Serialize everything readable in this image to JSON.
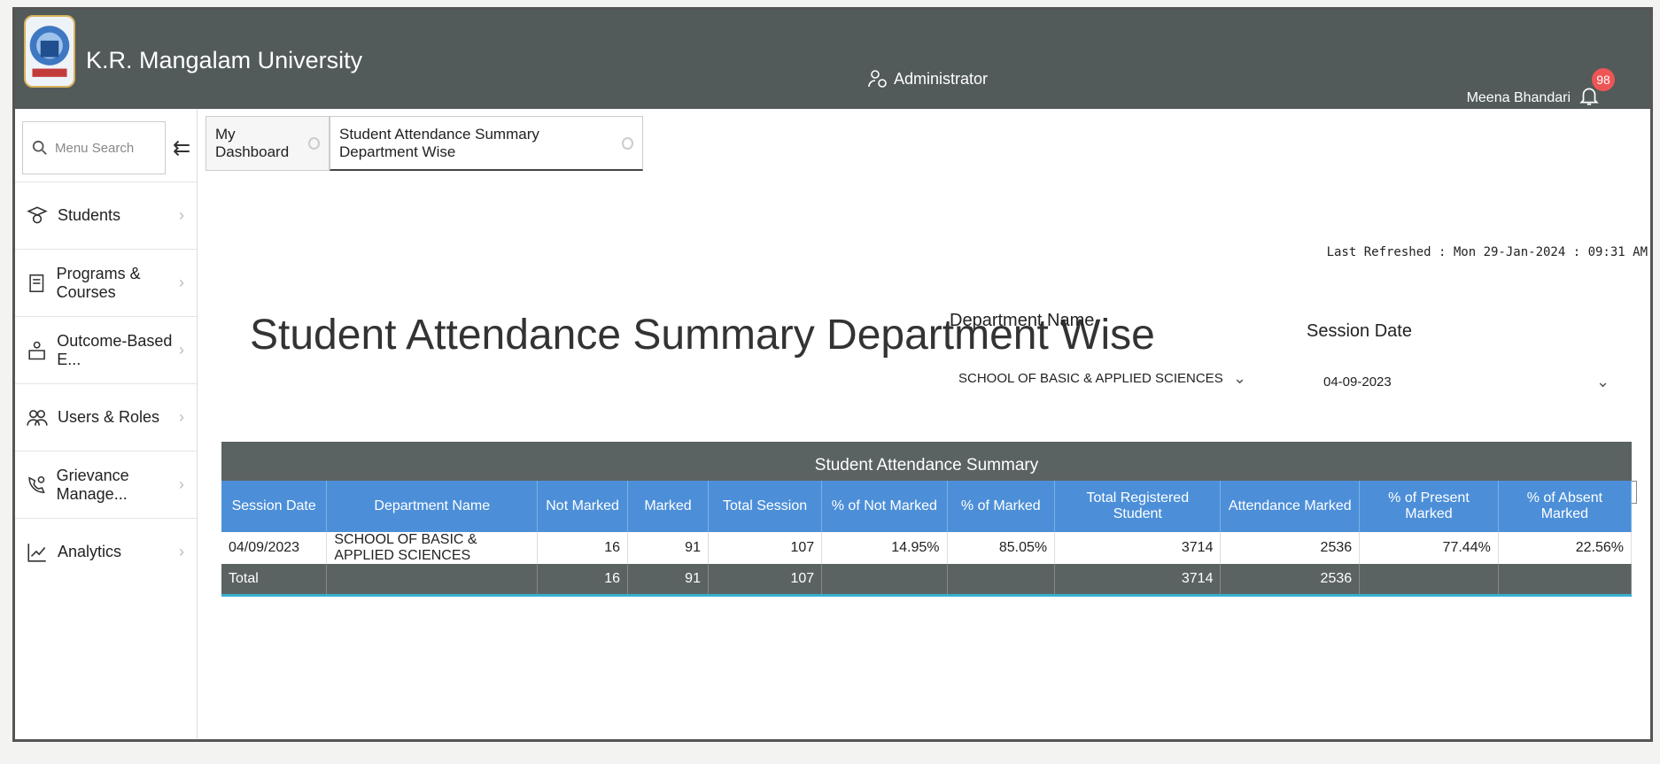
{
  "header": {
    "university_name": "K.R. Mangalam University",
    "role_label": "Administrator",
    "user_name": "Meena Bhandari",
    "notification_count": "98"
  },
  "sidebar": {
    "search_placeholder": "Menu Search",
    "items": [
      {
        "label": "Students",
        "icon": "student-icon"
      },
      {
        "label": "Programs & Courses",
        "icon": "book-icon"
      },
      {
        "label": "Outcome-Based E...",
        "icon": "outcome-icon"
      },
      {
        "label": "Users & Roles",
        "icon": "users-icon"
      },
      {
        "label": "Grievance Manage...",
        "icon": "grievance-icon"
      },
      {
        "label": "Analytics",
        "icon": "analytics-icon"
      }
    ]
  },
  "tabs": [
    {
      "label": "My Dashboard",
      "active": false
    },
    {
      "label": "Student Attendance Summary Department Wise",
      "active": true
    }
  ],
  "main": {
    "last_refreshed": "Last Refreshed : Mon 29-Jan-2024 : 09:31 AM",
    "title": "Student Attendance Summary Department Wise",
    "department_filter": {
      "label": "Department Name",
      "value": "SCHOOL OF BASIC & APPLIED SCIENCES"
    },
    "session_filter": {
      "label": "Session Date",
      "value": "04-09-2023"
    }
  },
  "table": {
    "title": "Student Attendance Summary",
    "columns": [
      "Session Date",
      "Department Name",
      "Not Marked",
      "Marked",
      "Total Session",
      "% of Not Marked",
      "% of Marked",
      "Total Registered Student",
      "Attendance Marked",
      "% of Present Marked",
      "% of Absent Marked"
    ],
    "rows": [
      [
        "04/09/2023",
        "SCHOOL OF BASIC & APPLIED SCIENCES",
        "16",
        "91",
        "107",
        "14.95%",
        "85.05%",
        "3714",
        "2536",
        "77.44%",
        "22.56%"
      ]
    ],
    "total_row": [
      "Total",
      "",
      "16",
      "91",
      "107",
      "",
      "",
      "3714",
      "2536",
      "",
      ""
    ]
  },
  "colors": {
    "topbar": "#525a5a",
    "table_header": "#4c8fd8",
    "badge": "#e55555"
  }
}
